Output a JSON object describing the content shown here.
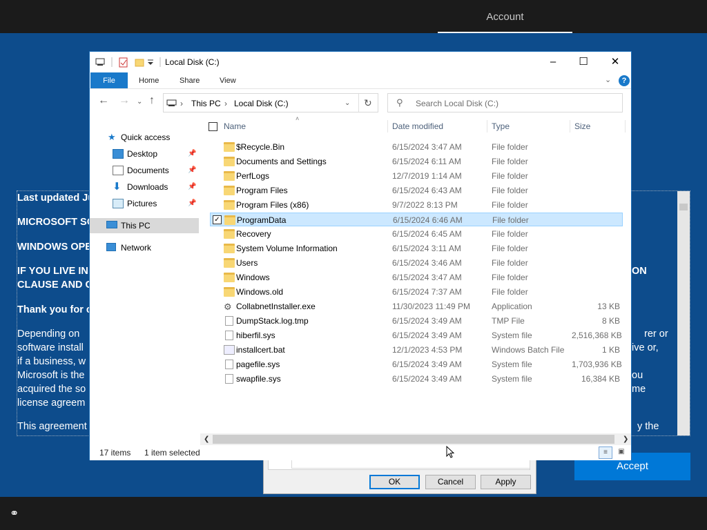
{
  "top_bar": {
    "tab_label": "Account"
  },
  "eula": {
    "lines": [
      "Last updated Ju",
      "MICROSOFT SO",
      "WINDOWS OPE",
      "IF YOU LIVE IN",
      "CLAUSE AND C",
      "Thank you for c",
      "Depending on",
      "software install",
      "if a business, w",
      "Microsoft is the",
      "acquired the so",
      "license agreem",
      "This agreement"
    ],
    "right_fragments": [
      "ON",
      "rer or",
      "ive or,",
      "ou",
      "me",
      "y the"
    ]
  },
  "accept_label": "Accept",
  "properties_dialog": {
    "ok": "OK",
    "cancel": "Cancel",
    "apply": "Apply"
  },
  "explorer": {
    "title": "Local Disk (C:)",
    "ribbon_tabs": [
      "File",
      "Home",
      "Share",
      "View"
    ],
    "help_label": "?",
    "address": {
      "root": "This PC",
      "current": "Local Disk (C:)"
    },
    "search_placeholder": "Search Local Disk (C:)",
    "nav": {
      "quick_access": "Quick access",
      "pinned": [
        "Desktop",
        "Documents",
        "Downloads",
        "Pictures"
      ],
      "this_pc": "This PC",
      "network": "Network"
    },
    "columns": {
      "name": "Name",
      "date": "Date modified",
      "type": "Type",
      "size": "Size"
    },
    "files": [
      {
        "name": "$Recycle.Bin",
        "date": "6/15/2024 3:47 AM",
        "type": "File folder",
        "size": "",
        "kind": "folder"
      },
      {
        "name": "Documents and Settings",
        "date": "6/15/2024 6:11 AM",
        "type": "File folder",
        "size": "",
        "kind": "link-folder"
      },
      {
        "name": "PerfLogs",
        "date": "12/7/2019 1:14 AM",
        "type": "File folder",
        "size": "",
        "kind": "folder"
      },
      {
        "name": "Program Files",
        "date": "6/15/2024 6:43 AM",
        "type": "File folder",
        "size": "",
        "kind": "folder"
      },
      {
        "name": "Program Files (x86)",
        "date": "9/7/2022 8:13 PM",
        "type": "File folder",
        "size": "",
        "kind": "folder"
      },
      {
        "name": "ProgramData",
        "date": "6/15/2024 6:46 AM",
        "type": "File folder",
        "size": "",
        "kind": "folder"
      },
      {
        "name": "Recovery",
        "date": "6/15/2024 6:45 AM",
        "type": "File folder",
        "size": "",
        "kind": "folder"
      },
      {
        "name": "System Volume Information",
        "date": "6/15/2024 3:11 AM",
        "type": "File folder",
        "size": "",
        "kind": "folder"
      },
      {
        "name": "Users",
        "date": "6/15/2024 3:46 AM",
        "type": "File folder",
        "size": "",
        "kind": "folder"
      },
      {
        "name": "Windows",
        "date": "6/15/2024 3:47 AM",
        "type": "File folder",
        "size": "",
        "kind": "folder"
      },
      {
        "name": "Windows.old",
        "date": "6/15/2024 7:37 AM",
        "type": "File folder",
        "size": "",
        "kind": "folder"
      },
      {
        "name": "CollabnetInstaller.exe",
        "date": "11/30/2023 11:49 PM",
        "type": "Application",
        "size": "13 KB",
        "kind": "exe"
      },
      {
        "name": "DumpStack.log.tmp",
        "date": "6/15/2024 3:49 AM",
        "type": "TMP File",
        "size": "8 KB",
        "kind": "file"
      },
      {
        "name": "hiberfil.sys",
        "date": "6/15/2024 3:49 AM",
        "type": "System file",
        "size": "2,516,368 KB",
        "kind": "sys"
      },
      {
        "name": "installcert.bat",
        "date": "12/1/2023 4:53 PM",
        "type": "Windows Batch File",
        "size": "1 KB",
        "kind": "bat"
      },
      {
        "name": "pagefile.sys",
        "date": "6/15/2024 3:49 AM",
        "type": "System file",
        "size": "1,703,936 KB",
        "kind": "sys"
      },
      {
        "name": "swapfile.sys",
        "date": "6/15/2024 3:49 AM",
        "type": "System file",
        "size": "16,384 KB",
        "kind": "sys"
      }
    ],
    "selected_index": 5,
    "status": {
      "count": "17 items",
      "selected": "1 item selected"
    }
  },
  "colors": {
    "accent": "#0078d7",
    "setup_bg": "#0d4c8c",
    "selection": "#cce8ff"
  }
}
